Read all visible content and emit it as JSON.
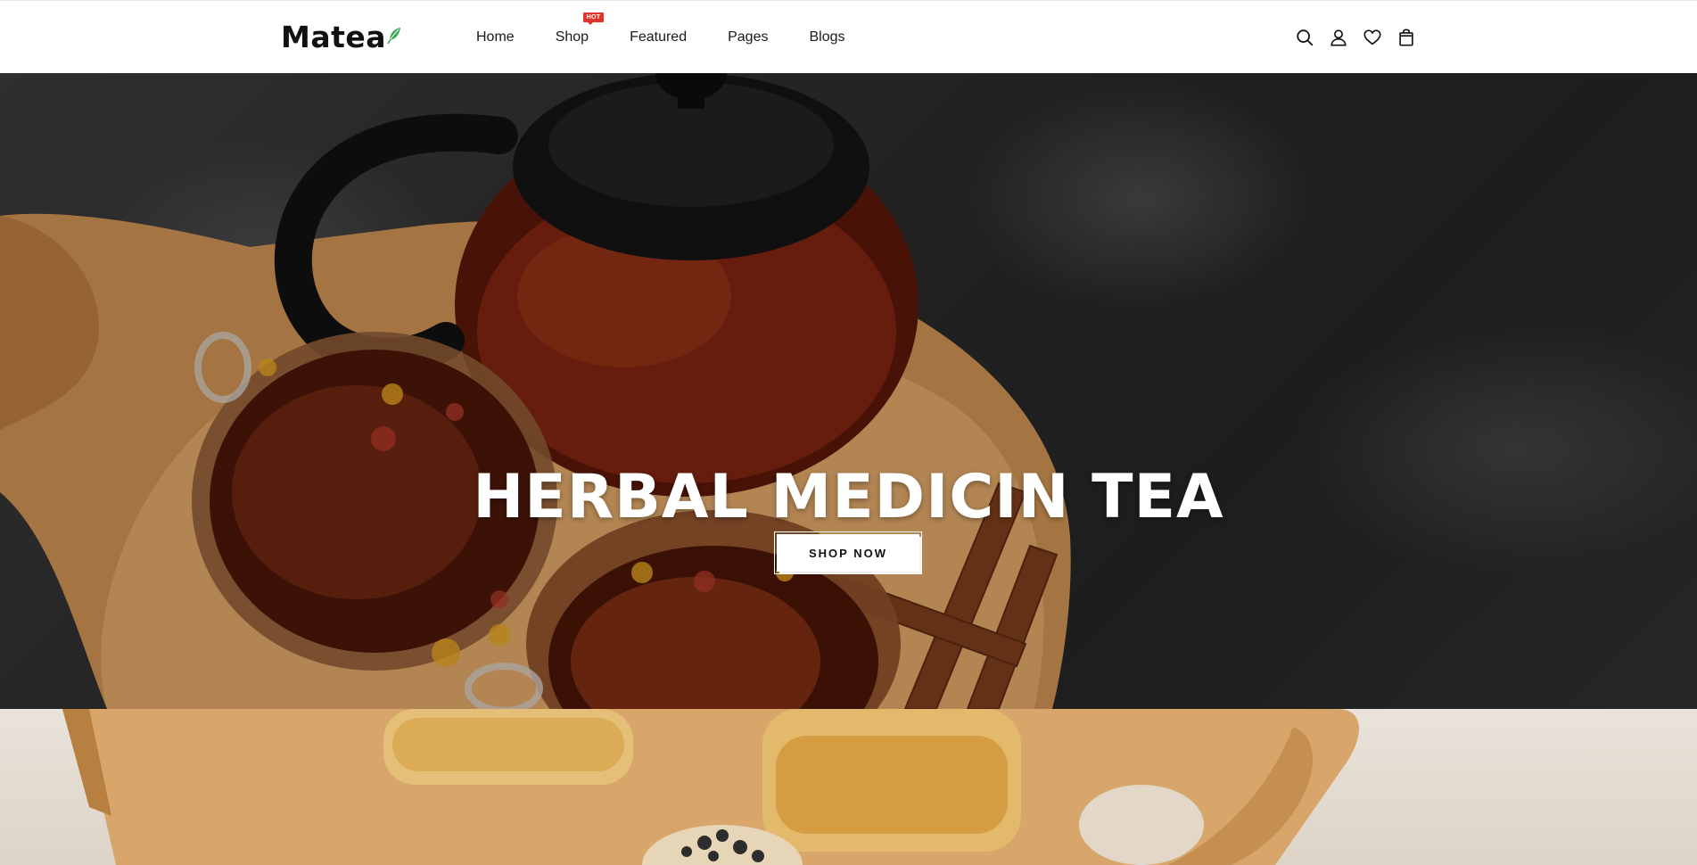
{
  "header": {
    "logo": "Matea",
    "nav": [
      {
        "label": "Home"
      },
      {
        "label": "Shop",
        "badge": "HOT"
      },
      {
        "label": "Featured"
      },
      {
        "label": "Pages"
      },
      {
        "label": "Blogs"
      }
    ],
    "icons": [
      "search-icon",
      "account-icon",
      "wishlist-icon",
      "cart-icon"
    ]
  },
  "hero": {
    "title": "HERBAL MEDICIN TEA",
    "button": "SHOP NOW"
  },
  "colors": {
    "badge": "#e0352b",
    "leaf": "#3aa657",
    "text": "#111111",
    "button_bg": "#ffffff"
  }
}
